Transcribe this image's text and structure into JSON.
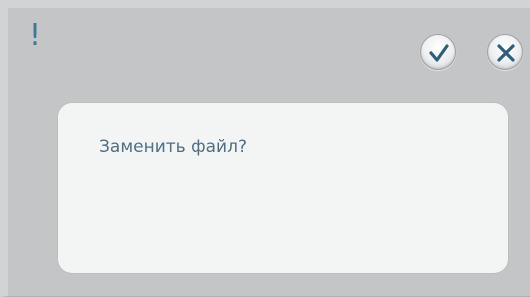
{
  "dialog": {
    "alert_glyph": "!",
    "message": "Заменить файл?",
    "buttons": {
      "ok_icon": "check-icon",
      "cancel_icon": "close-icon"
    }
  },
  "colors": {
    "accent": "#3d7a96",
    "background": "#c4c5c7",
    "content_background": "#f3f5f5"
  }
}
